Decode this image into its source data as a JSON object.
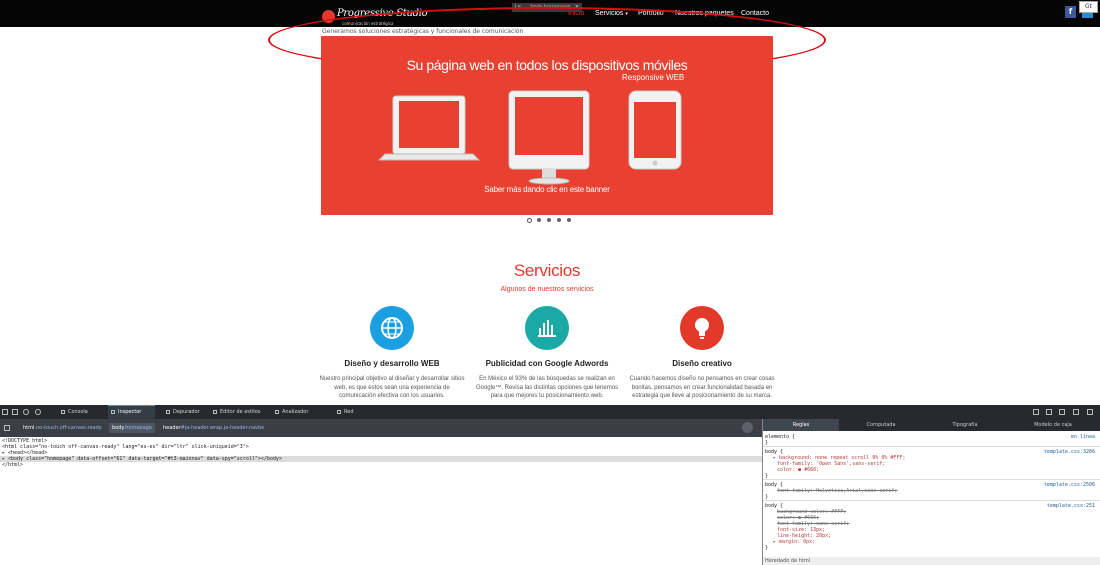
{
  "site": {
    "logo": {
      "name": "Progressive Studio",
      "tagline": "comunicación estratégica"
    },
    "nav": [
      {
        "label": "Inicio"
      },
      {
        "label": "Servicios",
        "caret": "▾"
      },
      {
        "label": "Portfolio"
      },
      {
        "label": "Nuestros paquetes"
      },
      {
        "label": "Contacto"
      }
    ],
    "tooltip": {
      "tag": "Le",
      "cls": "body.homepage",
      "close": "×"
    },
    "social": {
      "facebook": "f",
      "extra": "Gt"
    },
    "tagline": "Generamos soluciones estratégicas y funcionales de comunicación",
    "banner": {
      "title": "Su página web en todos los dispositivos móviles",
      "subtitle": "Responsive WEB",
      "cta": "Saber más dando clic en este banner",
      "slides": 5,
      "active_slide": 1
    },
    "services": {
      "title": "Servicios",
      "subtitle": "Algunos de nuestros servicios",
      "items": [
        {
          "title": "Diseño y desarrollo WEB",
          "icon": "globe-icon",
          "color": "#1a9fe0",
          "text": "Nuestro principal objetivo al diseñar y desarrollar sitios web, es que estos sean una experiencia de comunicación efectiva con los usuarios."
        },
        {
          "title": "Publicidad con Google Adwords",
          "icon": "bar-chart-icon",
          "color": "#1aa9a5",
          "text": "En México el 93% de las búsquedas se realizan en Google™. Revisa las distintas opciones que tenemos para que mejores tu posicionamiento web."
        },
        {
          "title": "Diseño creativo",
          "icon": "lightbulb-icon",
          "color": "#e3392a",
          "text": "Cuando hacemos diseño no pensamos en crear cosas bonitas, pensamos en crear funcionalidad basada en estrategia que lleve al posicionamiento de su marca."
        }
      ]
    }
  },
  "devtools": {
    "tabs": [
      "Consola",
      "Inspector",
      "Depurador",
      "Editor de estilos",
      "Analizador",
      "Red"
    ],
    "active_tab": "Inspector",
    "breadcrumbs": [
      {
        "tag": "html",
        "cls": ".no-touch.off-canvas-ready"
      },
      {
        "tag": "body",
        "cls": ".homepage"
      },
      {
        "tag": "header",
        "cls": "#ja-header.wrap.ja-header.navbe"
      }
    ],
    "markup": [
      "<!DOCTYPE html>",
      "<html class=\"no-touch off-canvas-ready\" lang=\"es-es\" dir=\"ltr\" slick-uniqueid=\"3\">",
      "▸ <head></head>",
      "▸ <body class=\"homepage\" data-offset=\"61\" data-target=\"#t3-mainnav\" data-spy=\"scroll\"></body>",
      "</html>"
    ],
    "rules_tabs": [
      "Reglas",
      "Computada",
      "Tipografía",
      "Modelo de caja"
    ],
    "rules": [
      {
        "selector": "elemento {",
        "source": "en línea",
        "lines": [
          "}"
        ]
      },
      {
        "selector": "body {",
        "source": "template.css:3266",
        "lines": [
          "▸ background: none repeat scroll 0% 0%  #FFF;",
          "font-family: 'Open Sans',sans-serif;",
          "color: ● #666;",
          "}"
        ]
      },
      {
        "selector": "body {",
        "source": "template.css:2506",
        "lines": [
          "font-family: Helvetica,Arial,sans-serif;",
          "}"
        ]
      },
      {
        "selector": "body {",
        "source": "template.css:251",
        "lines": [
          "background-color: #FFF;",
          "color: ● #666;",
          "font-family: sans-serif;",
          "font-size: 13px;",
          "line-height: 20px;",
          "▸ margin: 0px;",
          "}"
        ]
      }
    ],
    "inherited": "Heredado de html"
  }
}
